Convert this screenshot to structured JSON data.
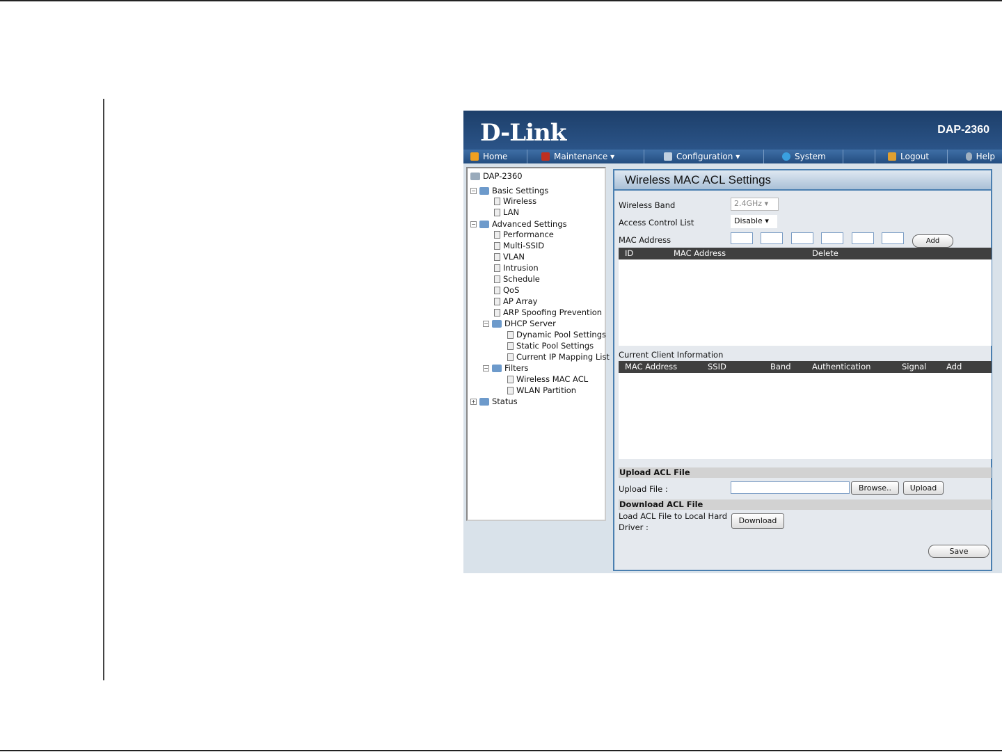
{
  "header": {
    "brand": "D-Link",
    "model": "DAP-2360"
  },
  "nav": [
    {
      "label": "Home",
      "color": "#f0a020"
    },
    {
      "label": "Maintenance ▾",
      "color": "#c03020"
    },
    {
      "label": "Configuration ▾",
      "color": "#c0d0e0"
    },
    {
      "label": "System",
      "color": "#3aa0e0"
    },
    {
      "label": "Logout",
      "color": "#e0a030"
    },
    {
      "label": "Help",
      "color": "#a0b0c0"
    }
  ],
  "tree": [
    "DAP-2360",
    "Basic Settings",
    "Wireless",
    "LAN",
    "Advanced Settings",
    "Performance",
    "Multi-SSID",
    "VLAN",
    "Intrusion",
    "Schedule",
    "QoS",
    "AP Array",
    "ARP Spoofing Prevention",
    "DHCP Server",
    "Dynamic Pool Settings",
    "Static Pool Settings",
    "Current IP Mapping List",
    "Filters",
    "Wireless MAC ACL",
    "WLAN Partition",
    "Status"
  ],
  "main": {
    "title": "Wireless MAC ACL Settings",
    "wireless_band_label": "Wireless Band",
    "wireless_band_value": "2.4GHz",
    "acl_label": "Access Control List",
    "acl_value": "Disable",
    "mac_label": "MAC Address",
    "add": "Add",
    "acl_table": {
      "headers": [
        "ID",
        "MAC Address",
        "Delete"
      ]
    },
    "client_title": "Current Client Information",
    "client_table": {
      "headers": [
        "MAC Address",
        "SSID",
        "Band",
        "Authentication",
        "Signal",
        "Add"
      ]
    },
    "upload_section": "Upload ACL File",
    "upload_label": "Upload File :",
    "browse": "Browse..",
    "upload": "Upload",
    "download_section": "Download ACL File",
    "download_label1": "Load ACL File to Local Hard",
    "download_label2": "Driver :",
    "download": "Download",
    "save": "Save"
  }
}
